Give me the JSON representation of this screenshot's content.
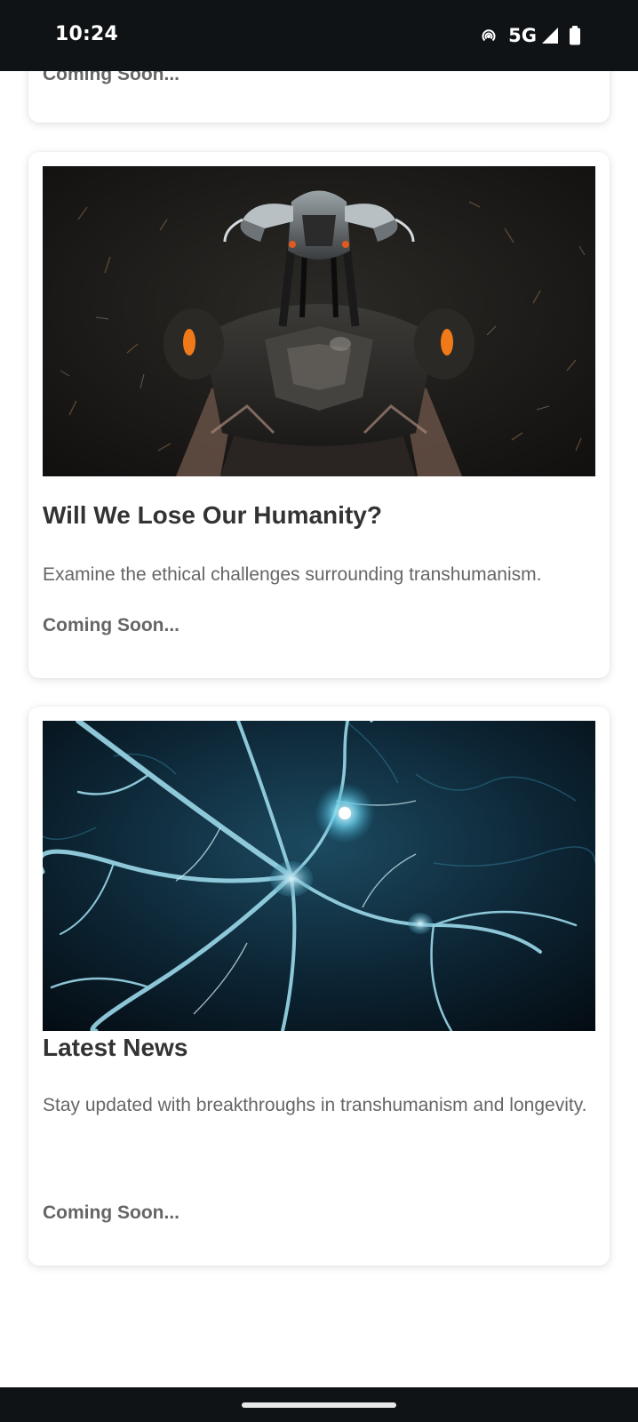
{
  "status_bar": {
    "time": "10:24",
    "network": "5G",
    "icons": [
      "hotspot-icon",
      "cell-signal-icon",
      "battery-icon"
    ]
  },
  "cards": [
    {
      "coming_label": "Coming Soon..."
    },
    {
      "image_icon": "robot-cyborg-image",
      "title": "Will We Lose Our Humanity?",
      "description": "Examine the ethical challenges surrounding transhumanism.",
      "coming_label": "Coming Soon..."
    },
    {
      "image_icon": "neurons-image",
      "title": "Latest News",
      "description": "Stay updated with breakthroughs in transhumanism and longevity.",
      "coming_label": "Coming Soon..."
    }
  ],
  "colors": {
    "status_bar_bg": "#0f1316",
    "title_text": "#333333",
    "body_text": "#666666",
    "neuron_accent": "#6fd0ea"
  }
}
